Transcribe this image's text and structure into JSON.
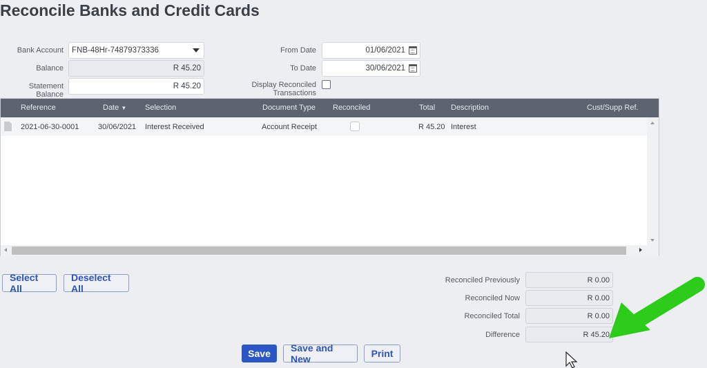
{
  "page": {
    "title": "Reconcile Banks and Credit Cards"
  },
  "form": {
    "bank_account_label": "Bank Account",
    "bank_account_value": "FNB-48Hr-74879373336",
    "balance_label": "Balance",
    "balance_value": "R 45.20",
    "statement_balance_label": "Statement Balance",
    "statement_balance_value": "R 45.20",
    "from_date_label": "From Date",
    "from_date_value": "01/06/2021",
    "to_date_label": "To Date",
    "to_date_value": "30/06/2021",
    "display_reconciled_label": "Display Reconciled Transactions",
    "display_reconciled_checked": false
  },
  "grid": {
    "columns": [
      "Reference",
      "Date",
      "Selection",
      "Document Type",
      "Reconciled",
      "Total",
      "Description",
      "Cust/Supp Ref."
    ],
    "sort_column": "Date",
    "sort_direction": "descending",
    "rows": [
      {
        "reference": "2021-06-30-0001",
        "date": "30/06/2021",
        "selection": "Interest Received",
        "document_type": "Account Receipt",
        "reconciled": false,
        "total": "R 45.20",
        "description": "Interest",
        "cust_supp_ref": ""
      }
    ]
  },
  "actions": {
    "select_all": "Select All",
    "deselect_all": "Deselect All",
    "save": "Save",
    "save_and_new": "Save and New",
    "print": "Print"
  },
  "summary": {
    "reconciled_previously_label": "Reconciled Previously",
    "reconciled_previously_value": "R 0.00",
    "reconciled_now_label": "Reconciled Now",
    "reconciled_now_value": "R 0.00",
    "reconciled_total_label": "Reconciled Total",
    "reconciled_total_value": "R 0.00",
    "difference_label": "Difference",
    "difference_value": "R 45.20"
  },
  "annotation": {
    "arrow_color": "#2ecc1a",
    "points_to": "difference-value"
  }
}
